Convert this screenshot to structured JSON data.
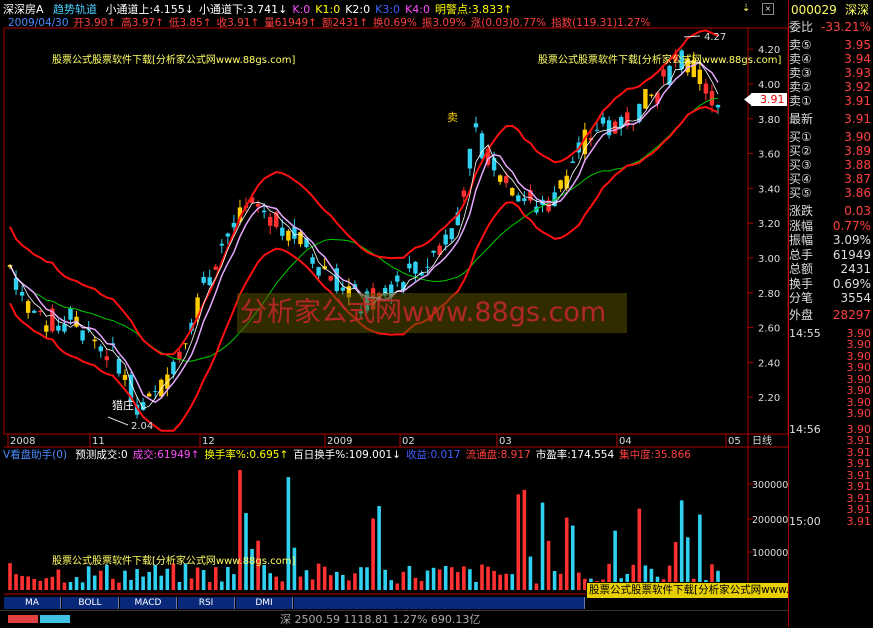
{
  "header": {
    "stock_name": "深深房A",
    "indicator_name": "趋势轨道",
    "params": [
      {
        "text": "小通道上:4.155↓",
        "color": "#ffffff"
      },
      {
        "text": "小通道下:3.741↓",
        "color": "#ffffff"
      },
      {
        "text": "K:0",
        "color": "#ff50ff"
      },
      {
        "text": "K1:0",
        "color": "#ffff00"
      },
      {
        "text": "K2:0",
        "color": "#ffffff"
      },
      {
        "text": "K3:0",
        "color": "#4060ff"
      },
      {
        "text": "K4:0",
        "color": "#ff50ff"
      },
      {
        "text": "明警点:3.833↑",
        "color": "#ffff00"
      }
    ],
    "quote_line": [
      {
        "text": "2009/04/30",
        "color": "#4a8cff"
      },
      {
        "text": "开3.90↑",
        "color": "#ff4040"
      },
      {
        "text": "高3.97↑",
        "color": "#ff4040"
      },
      {
        "text": "低3.85↑",
        "color": "#ff4040"
      },
      {
        "text": "收3.91↑",
        "color": "#ff4040"
      },
      {
        "text": "量61949↑",
        "color": "#ff4040"
      },
      {
        "text": "额2431↑",
        "color": "#ff4040"
      },
      {
        "text": "换0.69%",
        "color": "#ff4040"
      },
      {
        "text": "振3.09%",
        "color": "#ff4040"
      },
      {
        "text": "涨(0.03)0.77%",
        "color": "#ff4040"
      },
      {
        "text": "指数(119.31)1.27%",
        "color": "#ff4040"
      }
    ]
  },
  "watermarks": {
    "top_left": "股票公式股票软件下载[分析家公式网www.88gs.com]",
    "top_right": "股票公式股票软件下载[分析家公式网www.88gs.com]",
    "center": "分析家公式网www.88gs.com",
    "volume_panel": "股票公式股票软件下载[分析家公式网www.88gs.com]",
    "bottom_right": "股票公式股票软件下载[分析家公式网www.88gs.com]"
  },
  "annotations": {
    "high_label": "4.27",
    "low_label": "2.04",
    "low_marker": "猎庄",
    "mid_marker": "卖",
    "price_tag": "3.91"
  },
  "price_axis": [
    "4.20",
    "4.00",
    "3.80",
    "3.60",
    "3.40",
    "3.20",
    "3.00",
    "2.80",
    "2.60",
    "2.40",
    "2.20"
  ],
  "date_axis": [
    "2008",
    "11",
    "12",
    "2009",
    "02",
    "03",
    "04",
    "05"
  ],
  "date_axis_unit": "日线",
  "volume_panel": {
    "title": "V看盘助手(0)",
    "items": [
      {
        "text": "预测成交:0",
        "color": "#ffffff"
      },
      {
        "text": "成交:61949↑",
        "color": "#ff50ff"
      },
      {
        "text": "换手率%:0.695↑",
        "color": "#ffff00"
      },
      {
        "text": "百日换手%:109.001↓",
        "color": "#ffffff"
      },
      {
        "text": "收益:0.017",
        "color": "#4060ff"
      },
      {
        "text": "流通盘:8.917",
        "color": "#ff4040"
      },
      {
        "text": "市盈率:174.554",
        "color": "#ffffff"
      },
      {
        "text": "集中度:35.866",
        "color": "#ff4040"
      }
    ],
    "axis": [
      "300000",
      "200000",
      "100000"
    ]
  },
  "tabs": [
    "MA",
    "BOLL",
    "MACD",
    "RSI",
    "DMI"
  ],
  "bottom_status": "深 2500.59 1118.81 1.27% 690.13亿",
  "right_panel": {
    "code": "000029",
    "market": "深深",
    "weibi_label": "委比",
    "weibi_value": "-33.21%",
    "sell": [
      {
        "label": "卖⑤",
        "price": "3.95"
      },
      {
        "label": "卖④",
        "price": "3.94"
      },
      {
        "label": "卖③",
        "price": "3.93"
      },
      {
        "label": "卖②",
        "price": "3.92"
      },
      {
        "label": "卖①",
        "price": "3.91"
      }
    ],
    "latest_label": "最新",
    "latest_value": "3.91",
    "buy": [
      {
        "label": "买①",
        "price": "3.90"
      },
      {
        "label": "买②",
        "price": "3.89"
      },
      {
        "label": "买③",
        "price": "3.88"
      },
      {
        "label": "买④",
        "price": "3.87"
      },
      {
        "label": "买⑤",
        "price": "3.86"
      }
    ],
    "stats": [
      {
        "label": "涨跌",
        "value": "0.03",
        "color": "#ff4040"
      },
      {
        "label": "涨幅",
        "value": "0.77%",
        "color": "#ff4040"
      },
      {
        "label": "振幅",
        "value": "3.09%",
        "color": "#dddddd"
      },
      {
        "label": "总手",
        "value": "61949",
        "color": "#dddddd"
      },
      {
        "label": "总额",
        "value": "2431",
        "color": "#dddddd"
      },
      {
        "label": "换手",
        "value": "0.69%",
        "color": "#dddddd"
      },
      {
        "label": "分笔",
        "value": "3554",
        "color": "#dddddd"
      }
    ],
    "waipan_label": "外盘",
    "waipan_value": "28297",
    "ticks_a": [
      {
        "time": "14:55",
        "price": "3.90"
      },
      {
        "time": "",
        "price": "3.90"
      },
      {
        "time": "",
        "price": "3.90"
      },
      {
        "time": "",
        "price": "3.90"
      },
      {
        "time": "",
        "price": "3.90"
      },
      {
        "time": "",
        "price": "3.90"
      },
      {
        "time": "",
        "price": "3.90"
      },
      {
        "time": "",
        "price": "3.90"
      }
    ],
    "ticks_b": [
      {
        "time": "14:56",
        "price": "3.90"
      },
      {
        "time": "",
        "price": "3.91"
      },
      {
        "time": "",
        "price": "3.91"
      },
      {
        "time": "",
        "price": "3.91"
      },
      {
        "time": "",
        "price": "3.91"
      },
      {
        "time": "",
        "price": "3.91"
      },
      {
        "time": "",
        "price": "3.91"
      },
      {
        "time": "",
        "price": "3.91"
      },
      {
        "time": "15:00",
        "price": "3.91"
      }
    ]
  },
  "colors": {
    "up": "#ff3030",
    "down": "#30d0f0",
    "yellow_candle": "#ffcc00",
    "channel": "#ff1010",
    "mid_line": "#00cc00",
    "ma_line": "#e6a8ff",
    "axis_red": "#b00000"
  }
}
